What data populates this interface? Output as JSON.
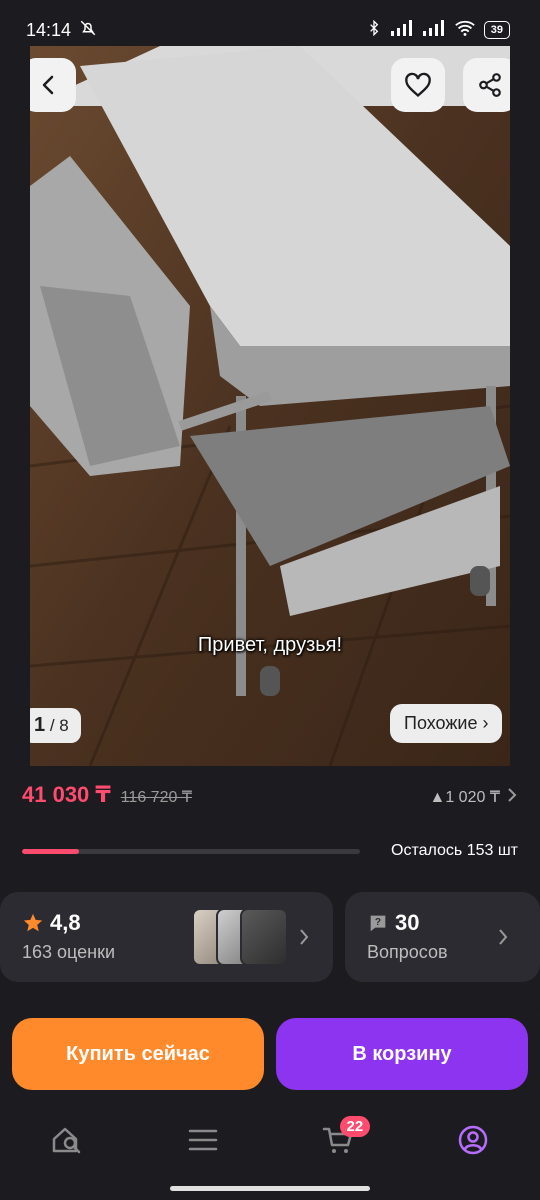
{
  "status_bar": {
    "time": "14:14",
    "battery": "39"
  },
  "hero": {
    "caption": "Привет, друзья!",
    "counter_current": "1",
    "counter_total": "/ 8",
    "similar_label": "Похожие ›"
  },
  "price": {
    "current": "41 030 ₸",
    "old": "116 720 ₸",
    "bonus": "▲1 020 ₸",
    "stock_label": "Осталось 153 шт",
    "stock_progress": 0.17
  },
  "rating_card": {
    "score": "4,8",
    "count_label": "163 оценки"
  },
  "questions_card": {
    "count": "30",
    "label": "Вопросов"
  },
  "actions": {
    "buy_now": "Купить сейчас",
    "add_to_cart": "В корзину"
  },
  "nav": {
    "cart_badge": "22"
  },
  "colors": {
    "price": "#ff4b6e",
    "buy": "#ff8a2b",
    "cart": "#8c34f0",
    "active_nav": "#b66dff"
  }
}
